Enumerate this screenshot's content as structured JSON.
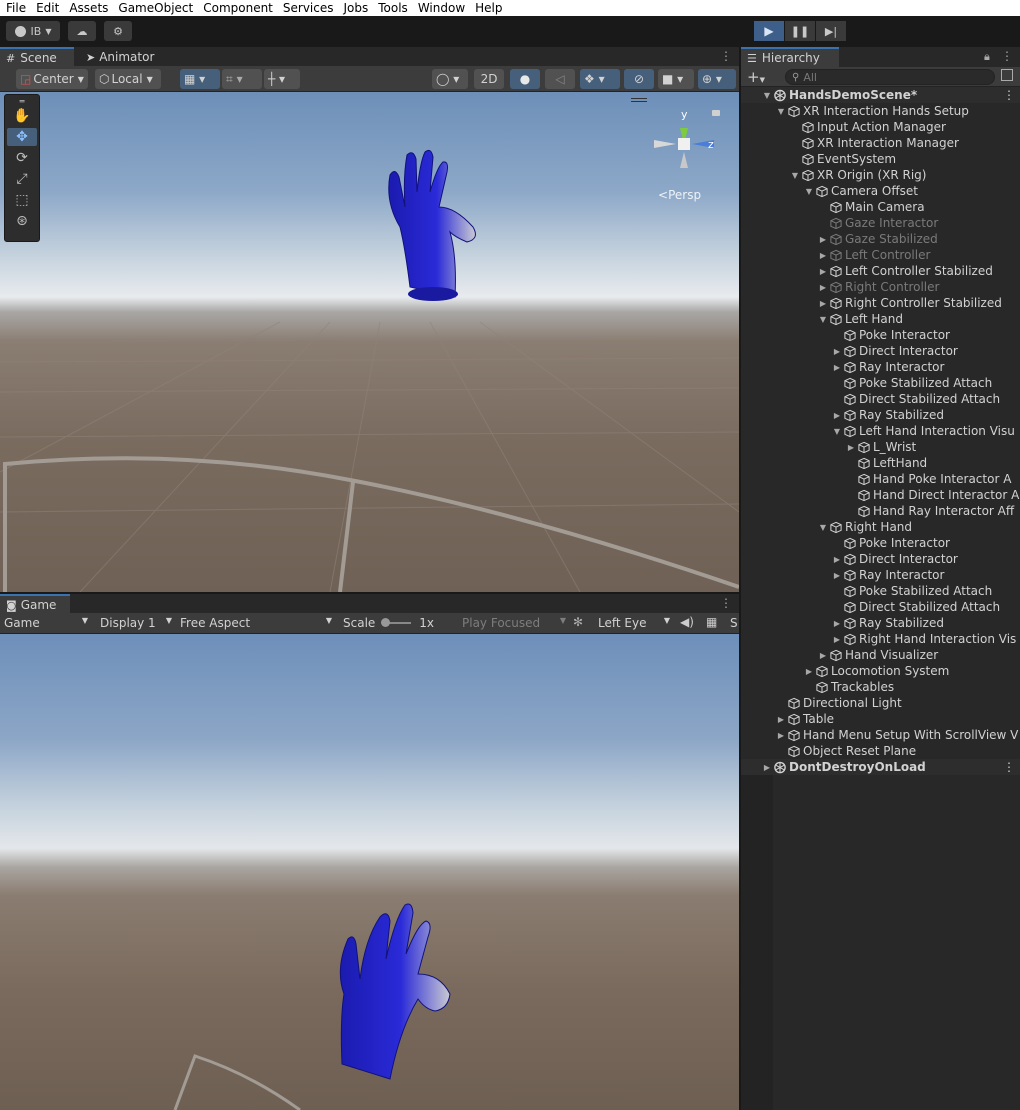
{
  "menu": [
    "File",
    "Edit",
    "Assets",
    "GameObject",
    "Component",
    "Services",
    "Jobs",
    "Tools",
    "Window",
    "Help"
  ],
  "toolbar": {
    "account": "IB"
  },
  "scene_panel": {
    "tabs": [
      "Scene",
      "Animator"
    ],
    "pivot": "Center",
    "space": "Local",
    "mode_2d": "2D",
    "persp_label": "Persp",
    "gizmo_y": "y",
    "gizmo_z": "z"
  },
  "game_panel": {
    "tab": "Game",
    "game_select": "Game",
    "display": "Display 1",
    "aspect": "Free Aspect",
    "scale_label": "Scale",
    "scale_value": "1x",
    "play_focused": "Play Focused",
    "eye": "Left Eye",
    "extra": "S"
  },
  "hierarchy": {
    "tab": "Hierarchy",
    "search_placeholder": "All",
    "rows": [
      {
        "label": "HandsDemoScene*",
        "depth": 0,
        "arrow": "down",
        "scene": true
      },
      {
        "label": "XR Interaction Hands Setup",
        "depth": 1,
        "arrow": "down"
      },
      {
        "label": "Input Action Manager",
        "depth": 2,
        "arrow": ""
      },
      {
        "label": "XR Interaction Manager",
        "depth": 2,
        "arrow": ""
      },
      {
        "label": "EventSystem",
        "depth": 2,
        "arrow": ""
      },
      {
        "label": "XR Origin (XR Rig)",
        "depth": 2,
        "arrow": "down"
      },
      {
        "label": "Camera Offset",
        "depth": 3,
        "arrow": "down"
      },
      {
        "label": "Main Camera",
        "depth": 4,
        "arrow": ""
      },
      {
        "label": "Gaze Interactor",
        "depth": 4,
        "arrow": "",
        "dim": true
      },
      {
        "label": "Gaze Stabilized",
        "depth": 4,
        "arrow": "right",
        "dim": true
      },
      {
        "label": "Left Controller",
        "depth": 4,
        "arrow": "right",
        "dim": true
      },
      {
        "label": "Left Controller Stabilized",
        "depth": 4,
        "arrow": "right"
      },
      {
        "label": "Right Controller",
        "depth": 4,
        "arrow": "right",
        "dim": true
      },
      {
        "label": "Right Controller Stabilized",
        "depth": 4,
        "arrow": "right"
      },
      {
        "label": "Left Hand",
        "depth": 4,
        "arrow": "down"
      },
      {
        "label": "Poke Interactor",
        "depth": 5,
        "arrow": ""
      },
      {
        "label": "Direct Interactor",
        "depth": 5,
        "arrow": "right"
      },
      {
        "label": "Ray Interactor",
        "depth": 5,
        "arrow": "right"
      },
      {
        "label": "Poke Stabilized Attach",
        "depth": 5,
        "arrow": ""
      },
      {
        "label": "Direct Stabilized Attach",
        "depth": 5,
        "arrow": ""
      },
      {
        "label": "Ray Stabilized",
        "depth": 5,
        "arrow": "right"
      },
      {
        "label": "Left Hand Interaction Visu",
        "depth": 5,
        "arrow": "down"
      },
      {
        "label": "L_Wrist",
        "depth": 6,
        "arrow": "right"
      },
      {
        "label": "LeftHand",
        "depth": 6,
        "arrow": ""
      },
      {
        "label": "Hand Poke Interactor A",
        "depth": 6,
        "arrow": ""
      },
      {
        "label": "Hand Direct Interactor A",
        "depth": 6,
        "arrow": ""
      },
      {
        "label": "Hand Ray Interactor Aff",
        "depth": 6,
        "arrow": ""
      },
      {
        "label": "Right Hand",
        "depth": 4,
        "arrow": "down"
      },
      {
        "label": "Poke Interactor",
        "depth": 5,
        "arrow": ""
      },
      {
        "label": "Direct Interactor",
        "depth": 5,
        "arrow": "right"
      },
      {
        "label": "Ray Interactor",
        "depth": 5,
        "arrow": "right"
      },
      {
        "label": "Poke Stabilized Attach",
        "depth": 5,
        "arrow": ""
      },
      {
        "label": "Direct Stabilized Attach",
        "depth": 5,
        "arrow": ""
      },
      {
        "label": "Ray Stabilized",
        "depth": 5,
        "arrow": "right"
      },
      {
        "label": "Right Hand Interaction Vis",
        "depth": 5,
        "arrow": "right"
      },
      {
        "label": "Hand Visualizer",
        "depth": 4,
        "arrow": "right"
      },
      {
        "label": "Locomotion System",
        "depth": 3,
        "arrow": "right"
      },
      {
        "label": "Trackables",
        "depth": 3,
        "arrow": ""
      },
      {
        "label": "Directional Light",
        "depth": 1,
        "arrow": ""
      },
      {
        "label": "Table",
        "depth": 1,
        "arrow": "right"
      },
      {
        "label": "Hand Menu Setup With ScrollView V",
        "depth": 1,
        "arrow": "right"
      },
      {
        "label": "Object Reset Plane",
        "depth": 1,
        "arrow": ""
      },
      {
        "label": "DontDestroyOnLoad",
        "depth": 0,
        "arrow": "right",
        "scene": true
      }
    ]
  },
  "colors": {
    "accent": "#3a72b0",
    "hand": "#1e1ec8",
    "play_active": "#3d5f8a"
  }
}
